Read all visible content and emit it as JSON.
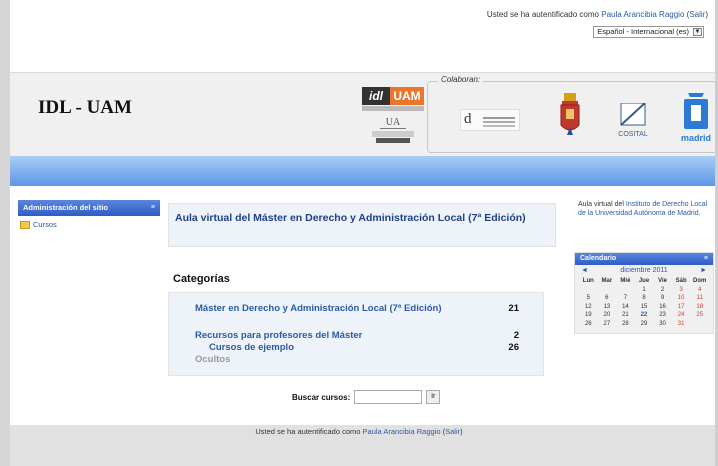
{
  "login": {
    "prefix": "Usted se ha autentificado como",
    "user": "Paula Arancibia Raggio",
    "open_paren": "(",
    "logout": "Salir",
    "close_paren": ")"
  },
  "language": {
    "selected": "Español - Internacional (es)"
  },
  "header": {
    "site_title": "IDL - UAM",
    "logo_idl": "idl",
    "logo_uam": "UAM",
    "logo_ua": "UA",
    "collaborators_label": "Colaboran:",
    "logo_dp": "d",
    "cosital_label": "COSITAL",
    "madrid_label": "madrid"
  },
  "admin_block": {
    "title": "Administración del sitio",
    "toggle": "≡",
    "item": "Cursos"
  },
  "main": {
    "aula_title": "Aula virtual del Máster en Derecho y Administración Local (7ª Edición)",
    "categories_title": "Categorías",
    "categories": [
      {
        "name": "Máster en Derecho y Administración Local (7ª Edición)",
        "count": "21"
      },
      {
        "name": "Recursos para profesores del Máster",
        "count": "2"
      },
      {
        "name": "Cursos de ejemplo",
        "count": "26"
      },
      {
        "name": "Ocultos",
        "count": ""
      }
    ],
    "search_label": "Buscar cursos:",
    "search_button": "Ir"
  },
  "right": {
    "aula_prefix": "Aula virtual del",
    "aula_link": "Instituto de Derecho Local de la Universidad Autónoma de Madrid",
    "aula_suffix": ".",
    "calendar_title": "Calendario",
    "calendar_toggle": "≡",
    "month": "diciembre 2011",
    "prev": "◄",
    "next": "►",
    "weekdays": [
      "Lun",
      "Mar",
      "Mié",
      "Jue",
      "Vie",
      "Sáb",
      "Dom"
    ],
    "days": [
      [
        "",
        "",
        "",
        "1",
        "2",
        "3",
        "4"
      ],
      [
        "5",
        "6",
        "7",
        "8",
        "9",
        "10",
        "11"
      ],
      [
        "12",
        "13",
        "14",
        "15",
        "16",
        "17",
        "18"
      ],
      [
        "19",
        "20",
        "21",
        "22",
        "23",
        "24",
        "25"
      ],
      [
        "26",
        "27",
        "28",
        "29",
        "30",
        "31",
        ""
      ]
    ],
    "today": "22"
  },
  "colors": {
    "link": "#2b5aa6",
    "block_header": "#2f5cc4",
    "weekend": "#d23b2b",
    "blue_bar": "#5c97e6"
  }
}
